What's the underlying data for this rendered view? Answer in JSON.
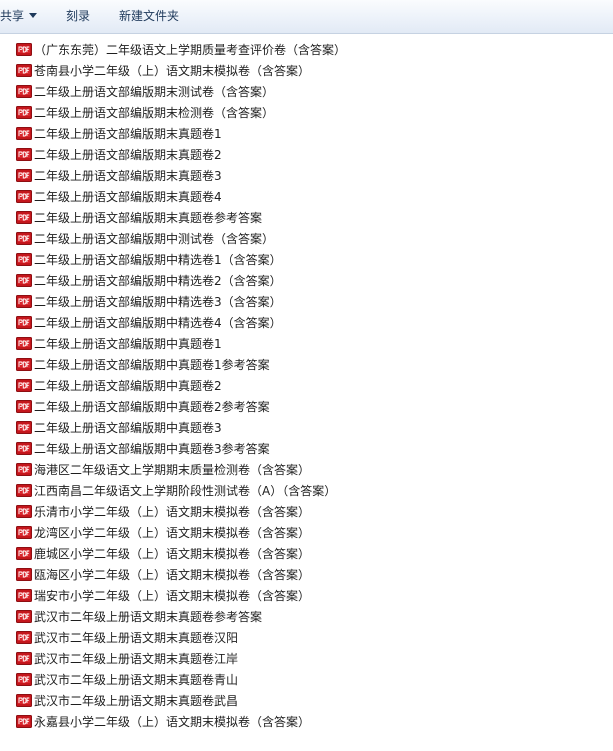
{
  "toolbar": {
    "share_label": "共享",
    "burn_label": "刻录",
    "new_folder_label": "新建文件夹"
  },
  "icons": {
    "file_icon": "pdf-icon",
    "file_icon_color": "#c4161c"
  },
  "files": [
    "（广东东莞）二年级语文上学期质量考查评价卷（含答案）",
    "苍南县小学二年级（上）语文期末模拟卷（含答案）",
    "二年级上册语文部编版期末测试卷（含答案）",
    "二年级上册语文部编版期末检测卷（含答案）",
    "二年级上册语文部编版期末真题卷1",
    "二年级上册语文部编版期末真题卷2",
    "二年级上册语文部编版期末真题卷3",
    "二年级上册语文部编版期末真题卷4",
    "二年级上册语文部编版期末真题卷参考答案",
    "二年级上册语文部编版期中测试卷（含答案）",
    "二年级上册语文部编版期中精选卷1（含答案）",
    "二年级上册语文部编版期中精选卷2（含答案）",
    "二年级上册语文部编版期中精选卷3（含答案）",
    "二年级上册语文部编版期中精选卷4（含答案）",
    "二年级上册语文部编版期中真题卷1",
    "二年级上册语文部编版期中真题卷1参考答案",
    "二年级上册语文部编版期中真题卷2",
    "二年级上册语文部编版期中真题卷2参考答案",
    "二年级上册语文部编版期中真题卷3",
    "二年级上册语文部编版期中真题卷3参考答案",
    "海港区二年级语文上学期期末质量检测卷（含答案）",
    "江西南昌二年级语文上学期阶段性测试卷（A）（含答案）",
    "乐清市小学二年级（上）语文期末模拟卷（含答案）",
    "龙湾区小学二年级（上）语文期末模拟卷（含答案）",
    "鹿城区小学二年级（上）语文期末模拟卷（含答案）",
    "瓯海区小学二年级（上）语文期末模拟卷（含答案）",
    "瑞安市小学二年级（上）语文期末模拟卷（含答案）",
    "武汉市二年级上册语文期末真题卷参考答案",
    "武汉市二年级上册语文期末真题卷汉阳",
    "武汉市二年级上册语文期末真题卷江岸",
    "武汉市二年级上册语文期末真题卷青山",
    "武汉市二年级上册语文期末真题卷武昌",
    "永嘉县小学二年级（上）语文期末模拟卷（含答案）"
  ]
}
